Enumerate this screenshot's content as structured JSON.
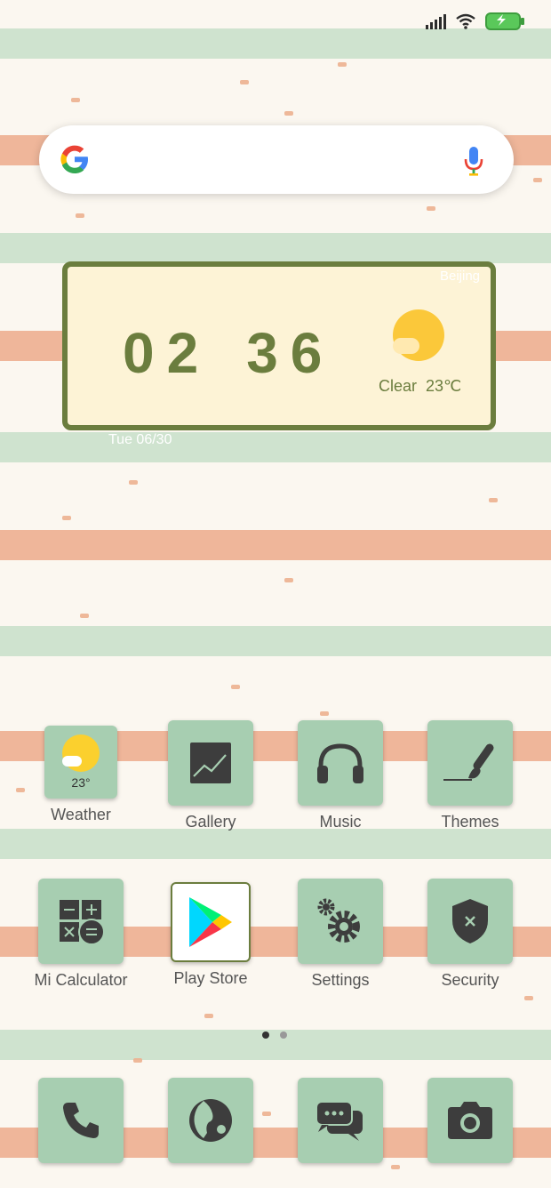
{
  "status_bar": {
    "signal_icon": "signal-bars-icon",
    "wifi_icon": "wifi-icon",
    "battery_icon": "battery-charging-icon"
  },
  "search": {
    "logo_icon": "google-g-icon",
    "mic_icon": "mic-icon"
  },
  "clock_widget": {
    "city": "Beijing",
    "hours": "02",
    "minutes": "36",
    "condition": "Clear",
    "temperature": "23℃",
    "date": "Tue 06/30"
  },
  "apps_row1": [
    {
      "label": "Weather",
      "icon": "weather-icon",
      "badge": "23°"
    },
    {
      "label": "Gallery",
      "icon": "gallery-icon"
    },
    {
      "label": "Music",
      "icon": "headphones-icon"
    },
    {
      "label": "Themes",
      "icon": "brush-icon"
    }
  ],
  "apps_row2": [
    {
      "label": "Mi Calculator",
      "icon": "calculator-icon"
    },
    {
      "label": "Play Store",
      "icon": "play-store-icon"
    },
    {
      "label": "Settings",
      "icon": "gear-icon"
    },
    {
      "label": "Security",
      "icon": "shield-icon"
    }
  ],
  "dock": [
    {
      "icon": "phone-icon"
    },
    {
      "icon": "browser-icon"
    },
    {
      "icon": "messages-icon"
    },
    {
      "icon": "camera-icon"
    }
  ],
  "page_indicator": {
    "pages": 2,
    "current": 1
  },
  "colors": {
    "accent_green": "#6b7d3e",
    "tile_green": "#a7ceb1",
    "stripe_green": "#cfe3cf",
    "stripe_orange": "#efb69a",
    "widget_bg": "#fdf3d6"
  }
}
